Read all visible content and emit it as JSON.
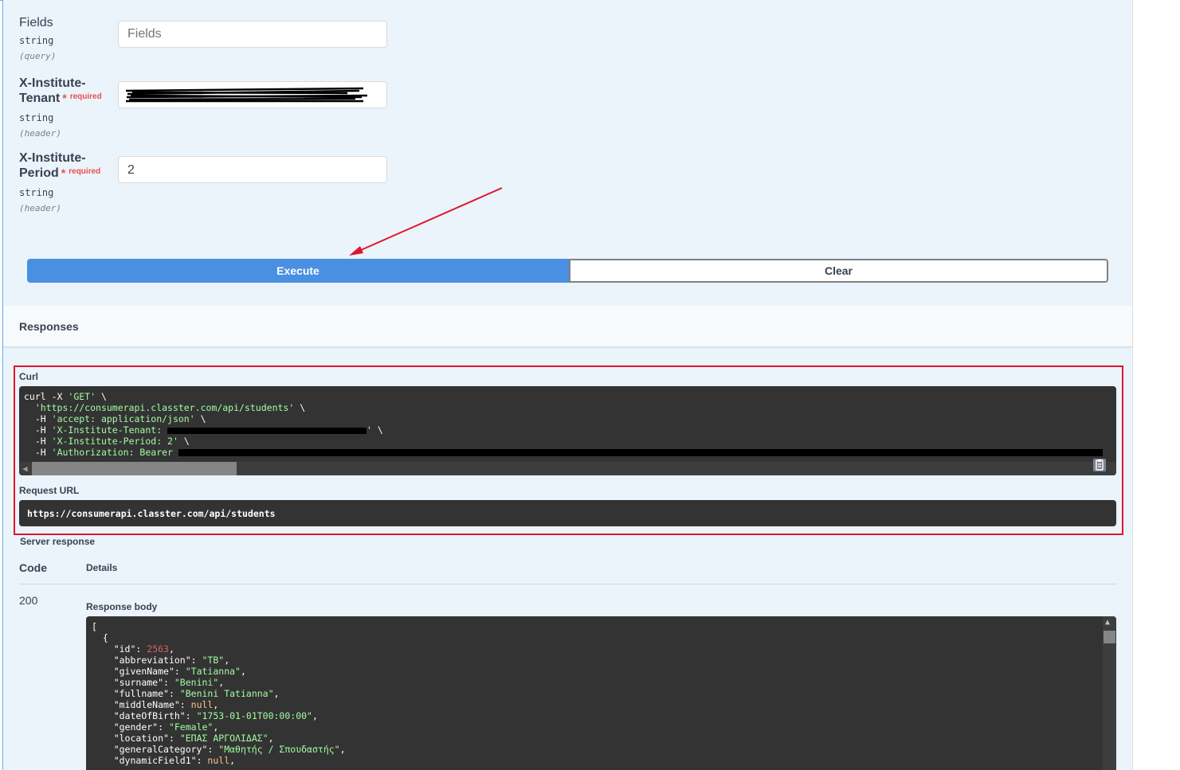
{
  "params": [
    {
      "name": "Fields",
      "name_line2": "",
      "type": "string",
      "in": "(query)",
      "required": false,
      "placeholder": "Fields",
      "value": ""
    },
    {
      "name": "X-Institute-",
      "name_line2": "Tenant",
      "type": "string",
      "in": "(header)",
      "required": true,
      "required_label": "required",
      "placeholder": "",
      "value": ""
    },
    {
      "name": "X-Institute-",
      "name_line2": "Period",
      "type": "string",
      "in": "(header)",
      "required": true,
      "required_label": "required",
      "placeholder": "",
      "value": "2"
    }
  ],
  "buttons": {
    "execute": "Execute",
    "clear": "Clear"
  },
  "responses": {
    "title": "Responses",
    "curl_label": "Curl",
    "curl_lines": {
      "l1_cmd": "curl -X ",
      "l1_str": "'GET'",
      "l1_tail": " \\",
      "l2_str": "'https://consumerapi.classter.com/api/students'",
      "l2_tail": " \\",
      "l3_flag": "-H ",
      "l3_str": "'accept: application/json'",
      "l3_tail": " \\",
      "l4_flag": "-H ",
      "l4_str": "'X-Institute-Tenant: ",
      "l4_end": "'",
      "l4_tail": " \\",
      "l5_flag": "-H ",
      "l5_str": "'X-Institute-Period: 2'",
      "l5_tail": " \\",
      "l6_flag": "-H ",
      "l6_str": "'Authorization: Bearer "
    },
    "request_url_label": "Request URL",
    "request_url": "https://consumerapi.classter.com/api/students",
    "server_response_label": "Server response",
    "col_code": "Code",
    "col_details": "Details",
    "status_code": "200",
    "response_body_label": "Response body",
    "body": {
      "open_bracket": "[",
      "open_brace": "{",
      "fields": [
        {
          "key": "\"id\"",
          "value": "2563",
          "kind": "num"
        },
        {
          "key": "\"abbreviation\"",
          "value": "\"TB\"",
          "kind": "str"
        },
        {
          "key": "\"givenName\"",
          "value": "\"Tatianna\"",
          "kind": "str"
        },
        {
          "key": "\"surname\"",
          "value": "\"Benini\"",
          "kind": "str"
        },
        {
          "key": "\"fullname\"",
          "value": "\"Benini Tatianna\"",
          "kind": "str"
        },
        {
          "key": "\"middleName\"",
          "value": "null",
          "kind": "kw"
        },
        {
          "key": "\"dateOfBirth\"",
          "value": "\"1753-01-01T00:00:00\"",
          "kind": "str"
        },
        {
          "key": "\"gender\"",
          "value": "\"Female\"",
          "kind": "str"
        },
        {
          "key": "\"location\"",
          "value": "\"ΕΠΑΣ ΑΡΓΟΛΙΔΑΣ\"",
          "kind": "str"
        },
        {
          "key": "\"generalCategory\"",
          "value": "\"Μαθητής / Σπουδαστής\"",
          "kind": "str"
        },
        {
          "key": "\"dynamicField1\"",
          "value": "null",
          "kind": "kw"
        }
      ]
    }
  },
  "colors": {
    "execute_bg": "#4990e2",
    "annotation_red": "#e0152e",
    "code_bg": "#333333",
    "code_string": "#a2fca2",
    "code_number": "#d36363",
    "code_null": "#fcc28c"
  }
}
